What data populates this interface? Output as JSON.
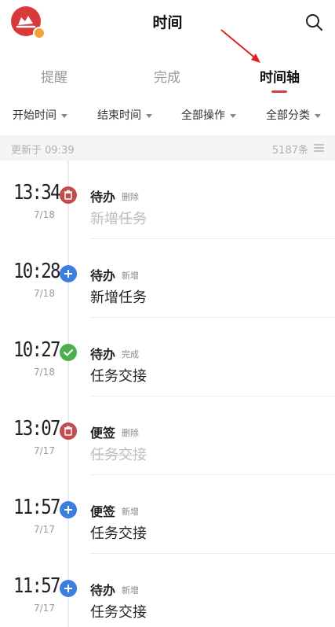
{
  "header": {
    "title": "时间",
    "logo_icon": "app-logo-icon",
    "search_icon": "search-icon"
  },
  "tabs": [
    {
      "label": "提醒",
      "active": false
    },
    {
      "label": "完成",
      "active": false
    },
    {
      "label": "时间轴",
      "active": true
    }
  ],
  "filters": [
    {
      "label": "开始时间"
    },
    {
      "label": "结束时间"
    },
    {
      "label": "全部操作"
    },
    {
      "label": "全部分类"
    }
  ],
  "status": {
    "updated": "更新于 09:39",
    "count": "5187条"
  },
  "colors": {
    "accent": "#c44444",
    "delete": "#c24d4d",
    "add": "#3b7ee0",
    "done": "#4cae4f"
  },
  "entries": [
    {
      "time": "13:34",
      "date": "7/18",
      "icon": "trash-icon",
      "kind": "待办",
      "action": "删除",
      "task": "新增任务",
      "deleted": true
    },
    {
      "time": "10:28",
      "date": "7/18",
      "icon": "plus-icon",
      "kind": "待办",
      "action": "新增",
      "task": "新增任务",
      "deleted": false
    },
    {
      "time": "10:27",
      "date": "7/18",
      "icon": "check-icon",
      "kind": "待办",
      "action": "完成",
      "task": "任务交接",
      "deleted": false
    },
    {
      "time": "13:07",
      "date": "7/17",
      "icon": "trash-icon",
      "kind": "便签",
      "action": "删除",
      "task": "任务交接",
      "deleted": true
    },
    {
      "time": "11:57",
      "date": "7/17",
      "icon": "plus-icon",
      "kind": "便签",
      "action": "新增",
      "task": "任务交接",
      "deleted": false
    },
    {
      "time": "11:57",
      "date": "7/17",
      "icon": "plus-icon",
      "kind": "待办",
      "action": "新增",
      "task": "任务交接",
      "deleted": false
    }
  ]
}
